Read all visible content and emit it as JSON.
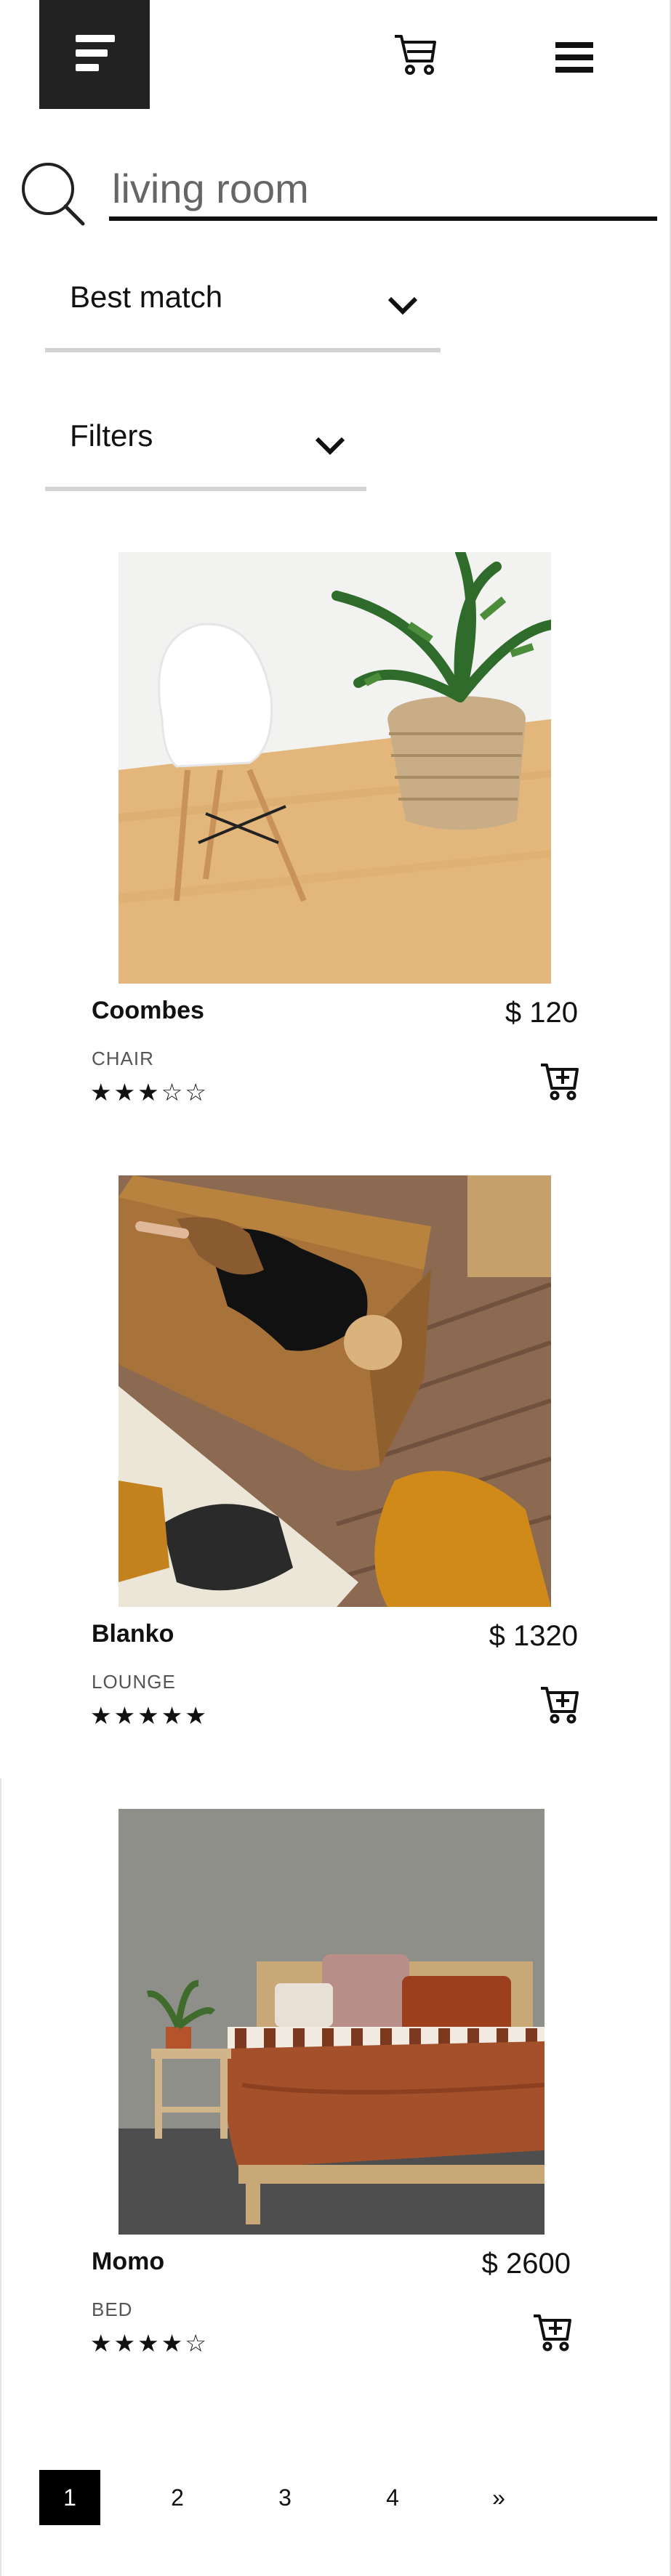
{
  "header": {
    "logo_icon": "menu-lines-logo-icon",
    "cart_icon": "cart-icon",
    "menu_icon": "hamburger-menu-icon"
  },
  "search": {
    "value": "living room",
    "icon": "search-icon"
  },
  "sort": {
    "selected": "Best match",
    "icon": "chevron-down-icon"
  },
  "filters": {
    "label": "Filters",
    "icon": "chevron-down-icon"
  },
  "products": [
    {
      "name": "Coombes",
      "price": "$ 120",
      "category": "CHAIR",
      "rating": 3,
      "max_rating": 5,
      "stars": "★★★☆☆",
      "add_icon": "add-to-cart-icon"
    },
    {
      "name": "Blanko",
      "price": "$ 1320",
      "category": "LOUNGE",
      "rating": 5,
      "max_rating": 5,
      "stars": "★★★★★",
      "add_icon": "add-to-cart-icon"
    },
    {
      "name": "Momo",
      "price": "$ 2600",
      "category": "BED",
      "rating": 4,
      "max_rating": 5,
      "stars": "★★★★☆",
      "add_icon": "add-to-cart-icon"
    }
  ],
  "pagination": {
    "pages": [
      "1",
      "2",
      "3",
      "4"
    ],
    "current": "1",
    "next": "»"
  },
  "colors": {
    "accent": "#111111",
    "underline": "#d3d3d3",
    "floor": "#e3b77c",
    "sofa": "#a8733a",
    "bedding": "#a4502a"
  }
}
